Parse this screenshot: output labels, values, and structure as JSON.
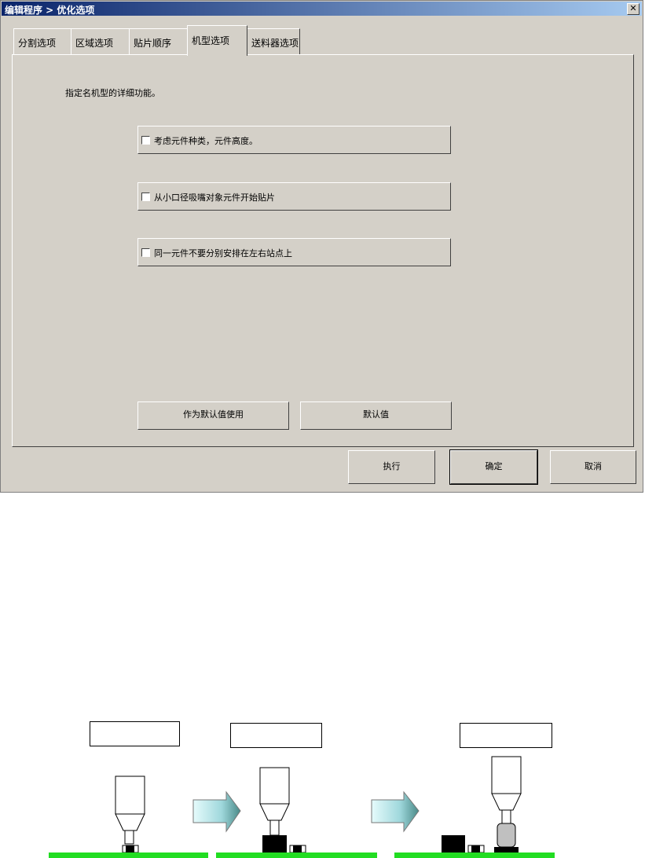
{
  "window": {
    "title": "编辑程序 > 优化选项",
    "close_glyph": "✕"
  },
  "tabs": [
    "分割选项",
    "区域选项",
    "贴片顺序",
    "机型选项",
    "送料器选项"
  ],
  "active_tab": "机型选项",
  "panel": {
    "description": "指定名机型的详细功能。",
    "options": [
      {
        "label": "考虑元件种类，元件高度。",
        "checked": false
      },
      {
        "label": "从小口径吸嘴对象元件开始贴片",
        "checked": false
      },
      {
        "label": "同一元件不要分别安排在左右站点上",
        "checked": false
      }
    ],
    "use_as_default_label": "作为默认值使用",
    "default_label": "默认值"
  },
  "footer": {
    "execute_label": "执行",
    "ok_label": "确定",
    "cancel_label": "取消"
  },
  "diagram": {
    "board_color": "#22dd22",
    "arrow_color": "#9fd8dc",
    "caption_boxes": [
      "",
      "",
      ""
    ]
  }
}
